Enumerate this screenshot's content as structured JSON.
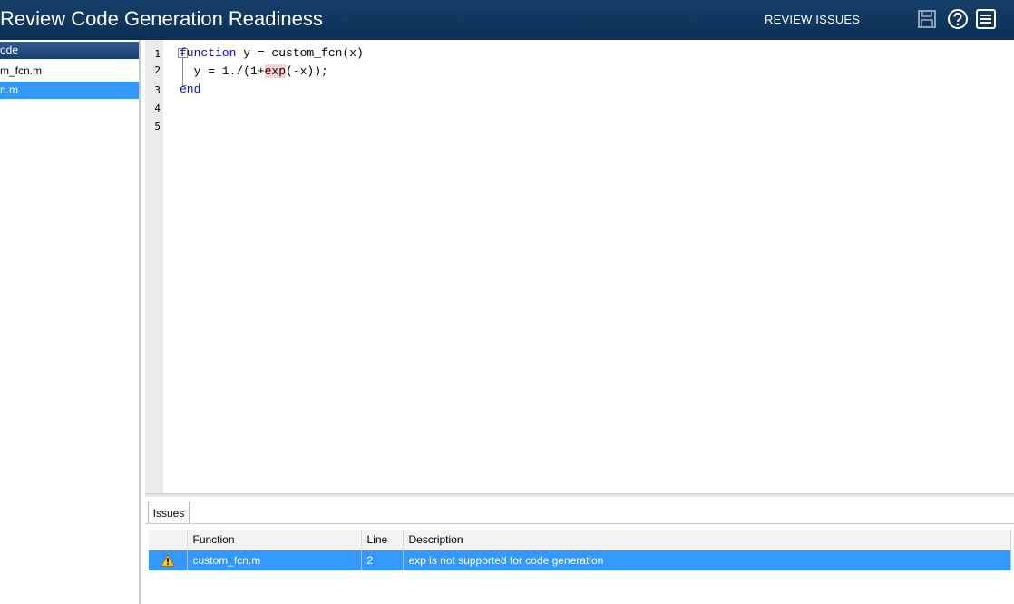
{
  "titlebar": {
    "title": "Review Code Generation Readiness",
    "review_issues_label": "REVIEW ISSUES",
    "icons": [
      "save-icon",
      "help-icon",
      "menu-icon"
    ]
  },
  "file_tree": {
    "items": [
      {
        "label": "ode",
        "selected_style": "header"
      },
      {
        "label": "m_fcn.m",
        "selected_style": "none"
      },
      {
        "label": "n.m",
        "selected_style": "selected"
      }
    ]
  },
  "editor": {
    "line_numbers": [
      "1",
      "2",
      "3",
      "4",
      "5"
    ],
    "lines": [
      {
        "keyword": "function",
        "text": " y = custom_fcn(x)"
      },
      {
        "prefix": "  y = 1./(1+",
        "highlight": "exp",
        "suffix": "(-x));"
      },
      {
        "keyword": "end",
        "text": ""
      },
      {
        "text": ""
      },
      {
        "text": ""
      }
    ]
  },
  "issues": {
    "tab_label": "Issues",
    "columns": [
      "Function",
      "Line",
      "Description"
    ],
    "rows": [
      {
        "severity": "warning",
        "function": "custom_fcn.m",
        "line": "2",
        "description": "exp is not supported for code generation"
      }
    ]
  },
  "colors": {
    "titlebar": "#0c2f55",
    "selection": "#3399ff",
    "keyword": "#0000ff",
    "highlight": "#ffd0d0"
  }
}
